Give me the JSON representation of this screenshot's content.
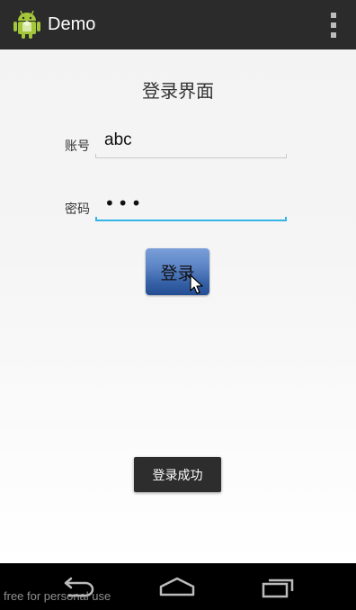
{
  "app": {
    "title": "Demo",
    "icon": "android-robot-icon"
  },
  "login": {
    "heading": "登录界面",
    "account_label": "账号",
    "account_value": "abc",
    "password_label": "密码",
    "password_value": "•••",
    "button_label": "登录"
  },
  "toast": {
    "message": "登录成功"
  },
  "watermark": "free for personal use",
  "colors": {
    "action_bar": "#2b2b2b",
    "focus_line": "#33b5e5",
    "button": "#3560a6"
  }
}
